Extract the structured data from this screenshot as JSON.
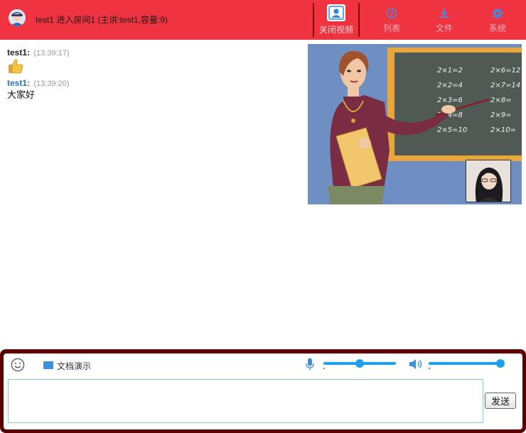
{
  "header": {
    "room_title": "test1 进入房间1 (主讲:test1,容量:9)",
    "buttons": [
      {
        "id": "video",
        "label": "关闭视频",
        "icon": "user-video-icon"
      },
      {
        "id": "list",
        "label": "列表",
        "icon": "question-circle-icon"
      },
      {
        "id": "file",
        "label": "文件",
        "icon": "download-icon"
      },
      {
        "id": "settings",
        "label": "系统",
        "icon": "gear-icon"
      }
    ]
  },
  "chat": {
    "messages": [
      {
        "name": "test1:",
        "time": "(13:39:17)",
        "body": "",
        "emoji": "thumbs-up-icon"
      },
      {
        "name": "test1:",
        "time": "(13:39:20)",
        "body": "大家好"
      }
    ]
  },
  "video": {
    "main_stream": "teacher-video",
    "pip_stream": "webcam-video",
    "board_lines": [
      "2×1=2",
      "2×2=4",
      "2×3=6",
      "2×4=8",
      "2×5=10",
      "2×6=12",
      "2×7=14",
      "2×8=",
      "2×9=",
      "2×10="
    ]
  },
  "composer": {
    "doc_label": "文档演示",
    "mic_volume": 0.5,
    "speaker_volume": 1.0,
    "input_value": "",
    "send_label": "发送"
  },
  "colors": {
    "header_bg": "#ef3340",
    "panel_border": "#5b0000",
    "accent": "#1e9ff2",
    "name_blue": "#2f6fb5"
  }
}
